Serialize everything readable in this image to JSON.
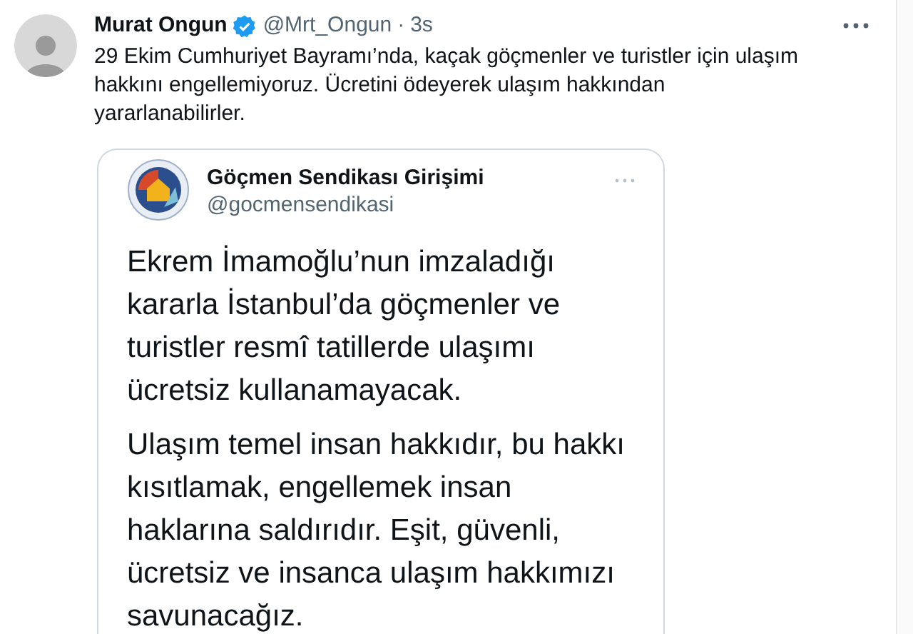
{
  "tweet": {
    "author": {
      "name": "Murat Ongun",
      "verified": true,
      "handle": "@Mrt_Ongun",
      "separator": "·",
      "time": "3s"
    },
    "text": "29 Ekim Cumhuriyet Bayramı’nda, kaçak göçmenler ve turistler için ulaşım hakkını engellemiyoruz. Ücretini ödeyerek ulaşım hakkından yararlanabilirler.",
    "embedded_screenshot": {
      "author": {
        "name": "Göçmen Sendikası Girişimi",
        "handle": "@gocmensendikasi"
      },
      "paragraphs": [
        "Ekrem İmamoğlu’nun imzaladığı kararla İstanbul’da göçmenler ve turistler resmî tatillerde ulaşımı ücretsiz kullanamayacak.",
        "Ulaşım temel insan hakkıdır, bu hakkı kısıtlamak, engellemek insan haklarına saldırıdır. Eşit, güvenli, ücretsiz ve insanca ulaşım hakkımızı savunacağız."
      ]
    }
  }
}
